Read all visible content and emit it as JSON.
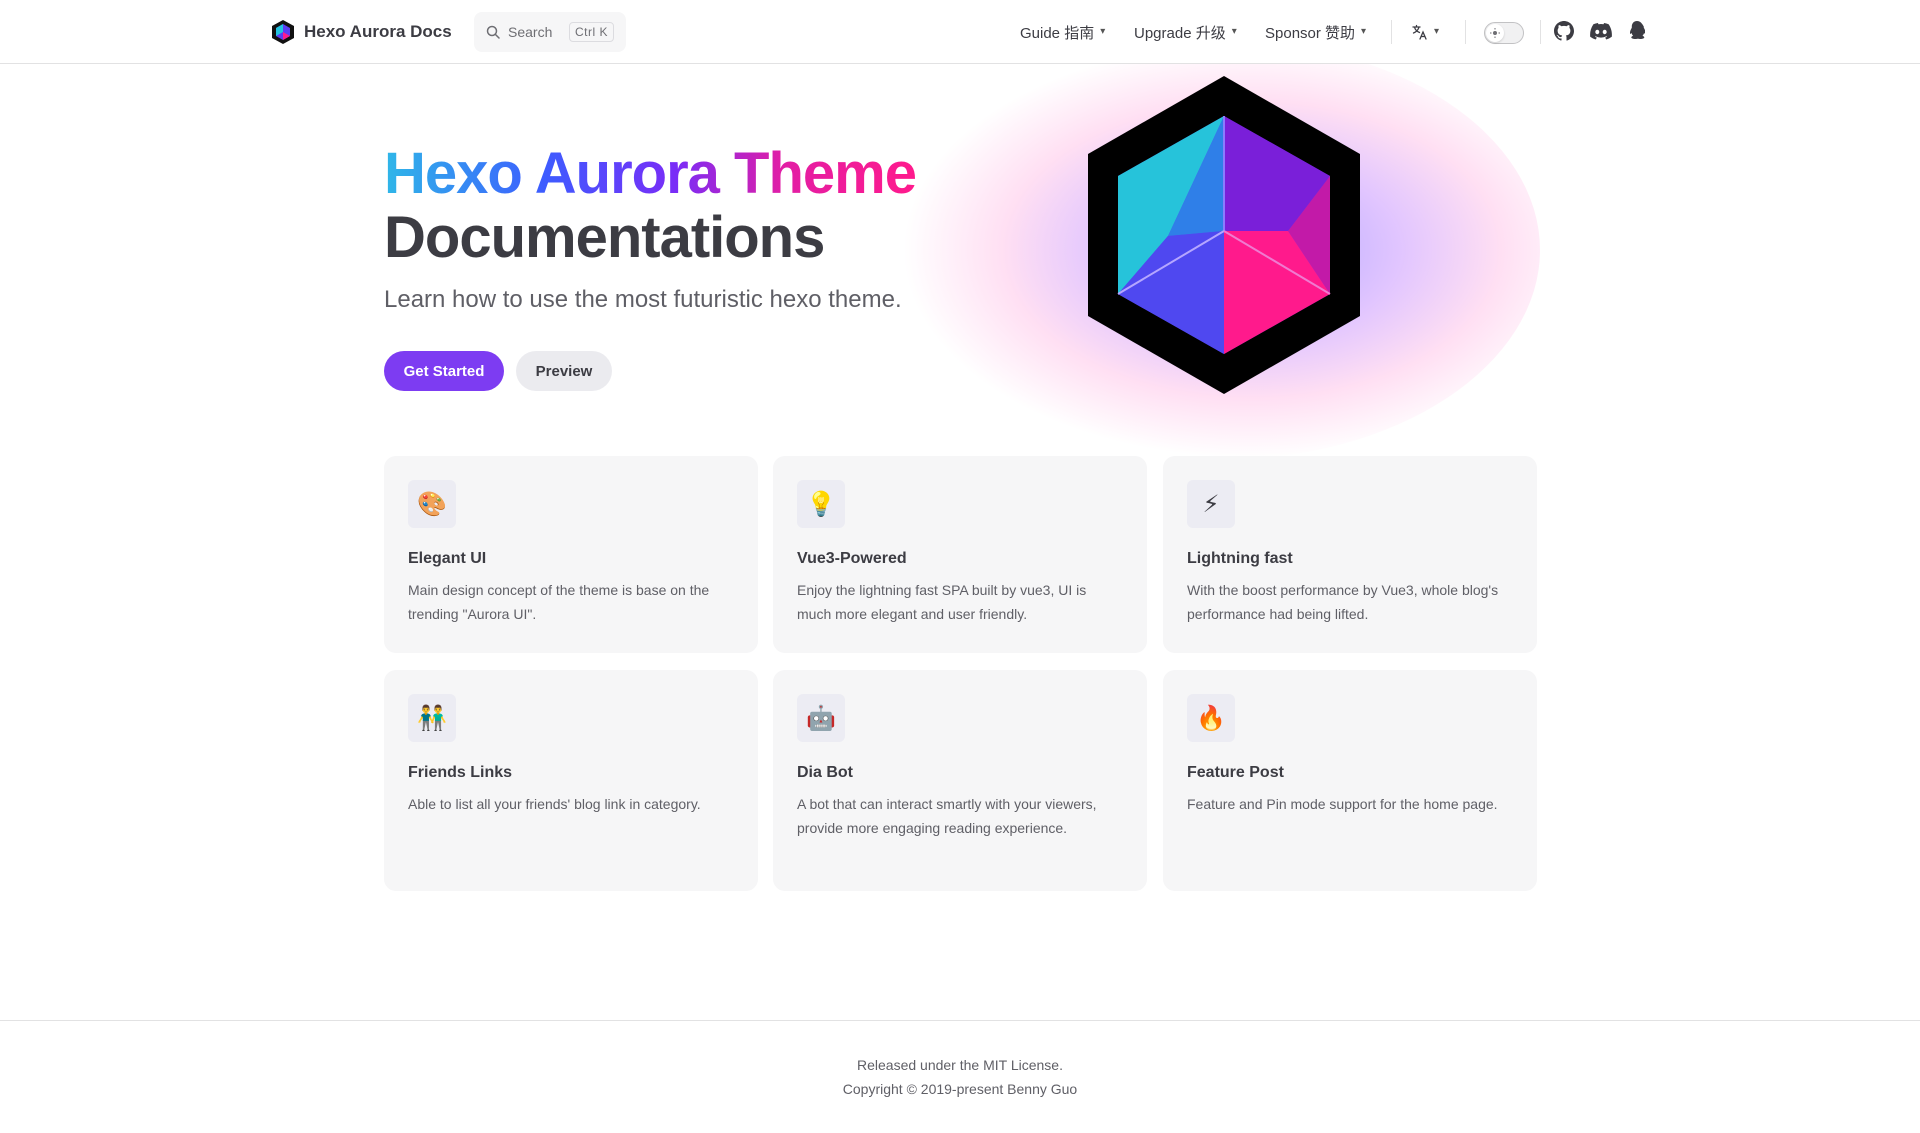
{
  "nav": {
    "brand_title": "Hexo Aurora Docs",
    "search": {
      "placeholder": "Search",
      "shortcut": "Ctrl K"
    },
    "menu": [
      {
        "label": "Guide 指南"
      },
      {
        "label": "Upgrade 升级"
      },
      {
        "label": "Sponsor 赞助"
      }
    ],
    "icons": [
      "translate-icon",
      "theme-toggle",
      "github-icon",
      "discord-icon",
      "qq-icon"
    ]
  },
  "hero": {
    "title_gradient": "Hexo Aurora Theme",
    "title_plain": "Documentations",
    "tagline": "Learn how to use the most futuristic hexo theme.",
    "primary_action": "Get Started",
    "secondary_action": "Preview"
  },
  "features": [
    {
      "icon": "🎨",
      "title": "Elegant UI",
      "desc": "Main design concept of the theme is base on the trending \"Aurora UI\"."
    },
    {
      "icon": "💡",
      "title": "Vue3-Powered",
      "desc": "Enjoy the lightning fast SPA built by vue3, UI is much more elegant and user friendly."
    },
    {
      "icon": "⚡",
      "title": "Lightning fast",
      "desc": "With the boost performance by Vue3, whole blog's performance had being lifted."
    },
    {
      "icon": "👬",
      "title": "Friends Links",
      "desc": "Able to list all your friends' blog link in category."
    },
    {
      "icon": "🤖",
      "title": "Dia Bot",
      "desc": "A bot that can interact smartly with your viewers, provide more engaging reading experience."
    },
    {
      "icon": "🔥",
      "title": "Feature Post",
      "desc": "Feature and Pin mode support for the home page."
    }
  ],
  "footer": {
    "license": "Released under the MIT License.",
    "copyright": "Copyright © 2019-present Benny Guo"
  },
  "colors": {
    "primary": "#7d3cf2",
    "gradient": [
      "#2fb7e8",
      "#3d5cff",
      "#7a2cf7",
      "#e21ea5",
      "#ff1a8c"
    ]
  }
}
